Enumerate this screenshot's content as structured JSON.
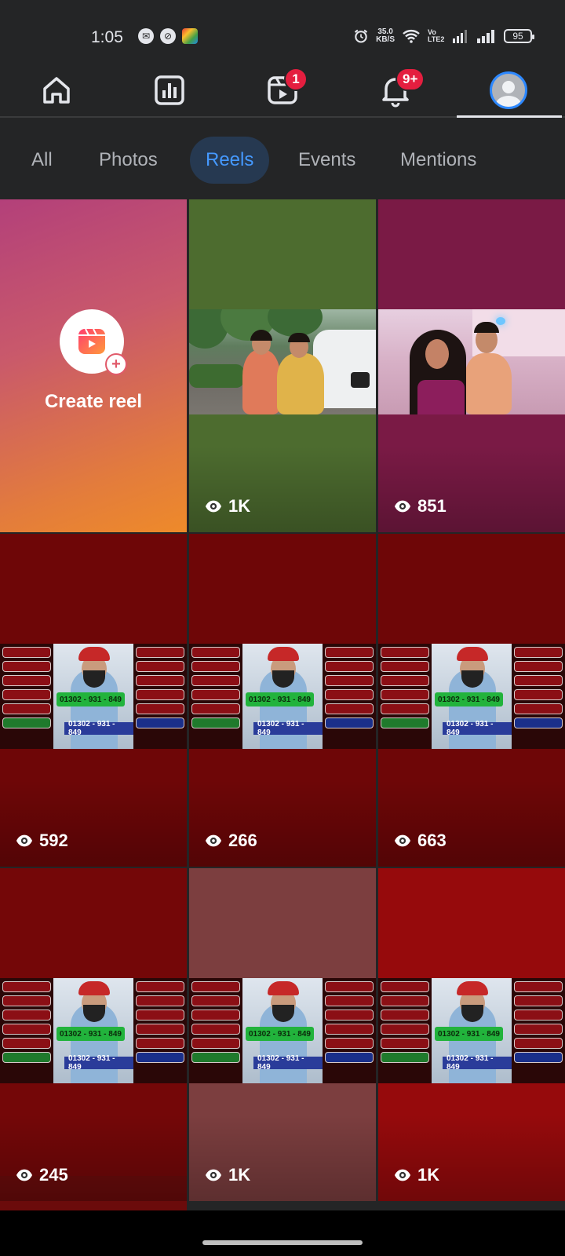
{
  "status_bar": {
    "time": "1:05",
    "net_speed_value": "35.0",
    "net_speed_unit": "KB/S",
    "volte": "Vo LTE2",
    "battery": "95"
  },
  "top_nav": {
    "items": [
      {
        "name": "home",
        "icon": "home-icon"
      },
      {
        "name": "dashboard",
        "icon": "bar-chart-icon"
      },
      {
        "name": "video",
        "icon": "video-icon",
        "badge": "1"
      },
      {
        "name": "notifications",
        "icon": "bell-icon",
        "badge": "9+"
      },
      {
        "name": "profile",
        "icon": "avatar-icon"
      }
    ],
    "active": "profile"
  },
  "tabs": [
    {
      "label": "All",
      "active": false
    },
    {
      "label": "Photos",
      "active": false
    },
    {
      "label": "Reels",
      "active": true
    },
    {
      "label": "Events",
      "active": false
    },
    {
      "label": "Mentions",
      "active": false
    }
  ],
  "reels": {
    "create_label": "Create reel",
    "items": [
      {
        "views": "1K",
        "bg": "#4d6c2f",
        "scene": "street"
      },
      {
        "views": "851",
        "bg": "#7a1a45",
        "scene": "room"
      },
      {
        "views": "592",
        "bg": "#6e0607",
        "scene": "poster",
        "phone": "01302 - 931 - 849"
      },
      {
        "views": "266",
        "bg": "#6e0607",
        "scene": "poster",
        "phone": "01302 - 931 - 849"
      },
      {
        "views": "663",
        "bg": "#6e0607",
        "scene": "poster",
        "phone": "01302 - 931 - 849"
      },
      {
        "views": "245",
        "bg": "#740708",
        "scene": "poster",
        "phone": "01302 - 931 - 849"
      },
      {
        "views": "1K",
        "bg": "#7c3e3f",
        "scene": "poster",
        "phone": "01302 - 931 - 849"
      },
      {
        "views": "1K",
        "bg": "#960a0c",
        "scene": "poster",
        "phone": "01302 - 931 - 849"
      }
    ]
  },
  "colors": {
    "background": "#242526",
    "accent": "#4599ff",
    "active_tab_bg": "#263951",
    "badge": "#e41e3f"
  }
}
